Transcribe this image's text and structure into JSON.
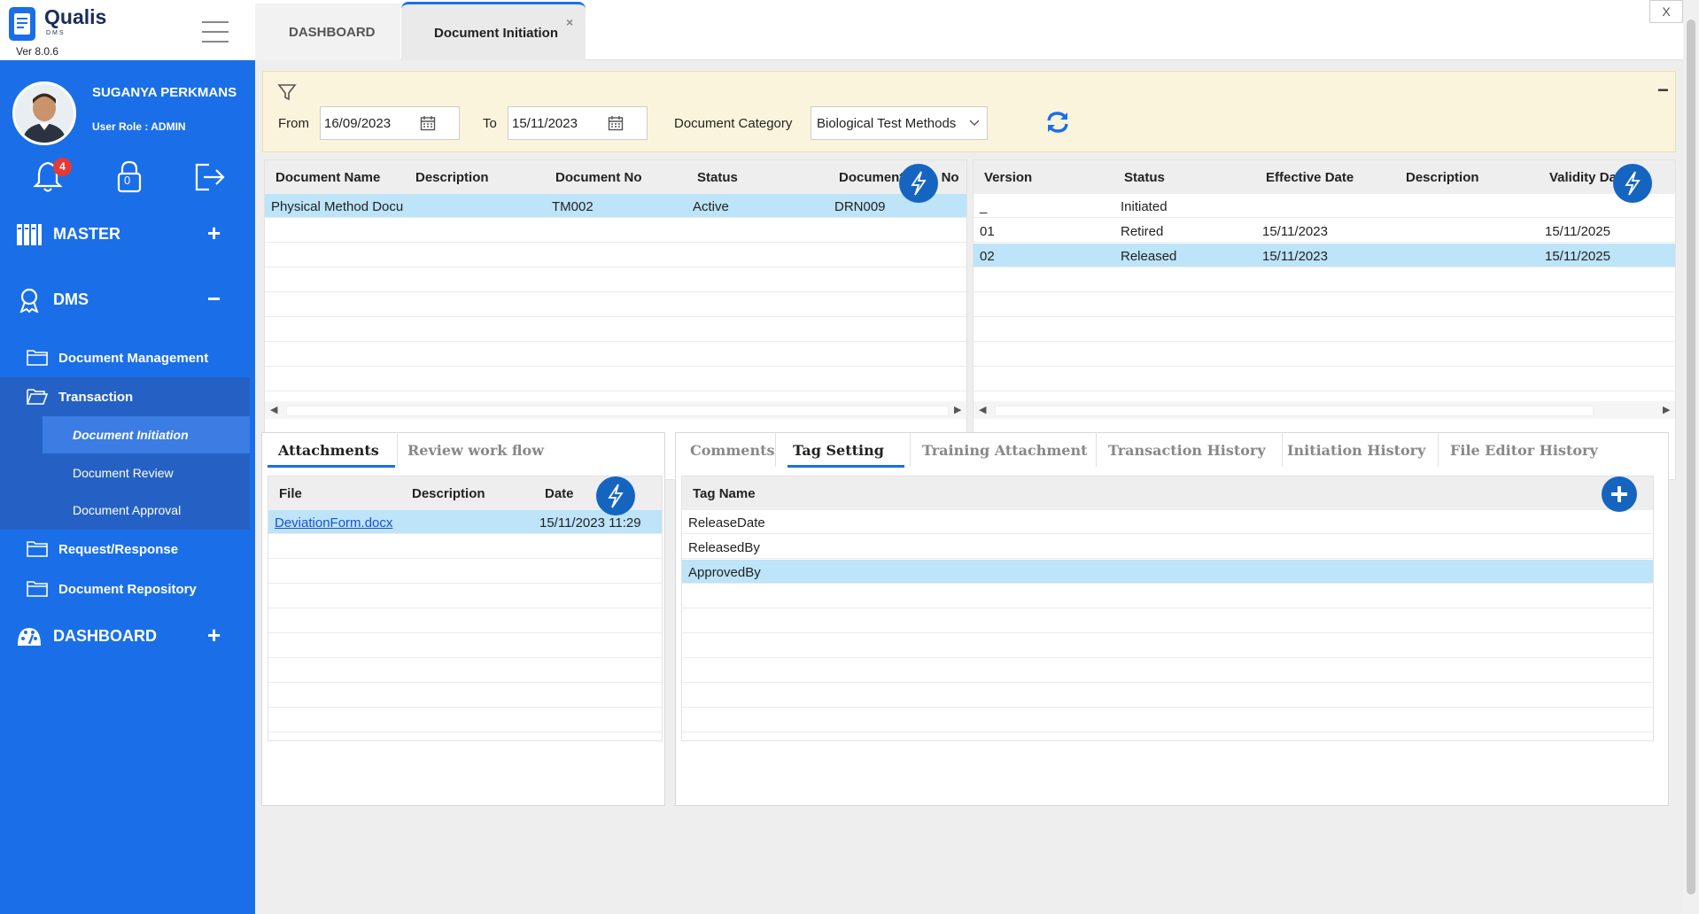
{
  "app": {
    "name": "Qualis",
    "sub": "DMS",
    "version": "Ver 8.0.6"
  },
  "user": {
    "name": "SUGANYA PERKMANS",
    "role": "User Role : ADMIN"
  },
  "sidebar": {
    "notification_count": "4",
    "lock_count": "0",
    "master": {
      "label": "MASTER",
      "toggle": "+"
    },
    "dms": {
      "label": "DMS",
      "toggle": "−"
    },
    "document_management": "Document Management",
    "transaction": "Transaction",
    "document_initiation": "Document Initiation",
    "document_review": "Document Review",
    "document_approval": "Document Approval",
    "request_response": "Request/Response",
    "document_repository": "Document Repository",
    "dashboard": {
      "label": "DASHBOARD",
      "toggle": "+"
    }
  },
  "tabs": {
    "dashboard": "DASHBOARD",
    "document_initiation": "Document Initiation",
    "close": "×"
  },
  "window": {
    "close": "X"
  },
  "filter": {
    "collapse": "−",
    "from_label": "From",
    "from_value": "16/09/2023",
    "to_label": "To",
    "to_value": "15/11/2023",
    "category_label": "Document Category",
    "category_value": "Biological Test Methods"
  },
  "documents_grid": {
    "headers": [
      "Document Name",
      "Description",
      "Document No",
      "Status",
      "Document Type No"
    ],
    "rows": [
      [
        "Physical Method Docu",
        "",
        "TM002",
        "Active",
        "DRN009"
      ]
    ]
  },
  "versions_grid": {
    "headers": [
      "Version",
      "Status",
      "Effective Date",
      "Description",
      "Validity Date"
    ],
    "rows": [
      [
        "_",
        "Initiated",
        "",
        "",
        ""
      ],
      [
        "01",
        "Retired",
        "15/11/2023",
        "",
        "15/11/2025"
      ],
      [
        "02",
        "Released",
        "15/11/2023",
        "",
        "15/11/2025"
      ]
    ]
  },
  "left_tabs": [
    "Attachments",
    "Review work flow"
  ],
  "attachments_grid": {
    "headers": [
      "File",
      "Description",
      "Date"
    ],
    "rows": [
      [
        "DeviationForm.docx",
        "",
        "15/11/2023 11:29"
      ]
    ]
  },
  "right_tabs": [
    "Comments",
    "Tag Setting",
    "Training Attachment",
    "Transaction History",
    "Initiation History",
    "File Editor History"
  ],
  "tags_grid": {
    "headers": [
      "Tag Name"
    ],
    "rows": [
      "ReleaseDate",
      "ReleasedBy",
      "ApprovedBy"
    ]
  },
  "colors": {
    "sidebar": "#1a6fe8",
    "selected_row": "#bde4f8",
    "action_button": "#1565c0",
    "filter_panel": "#fbf4dc"
  }
}
